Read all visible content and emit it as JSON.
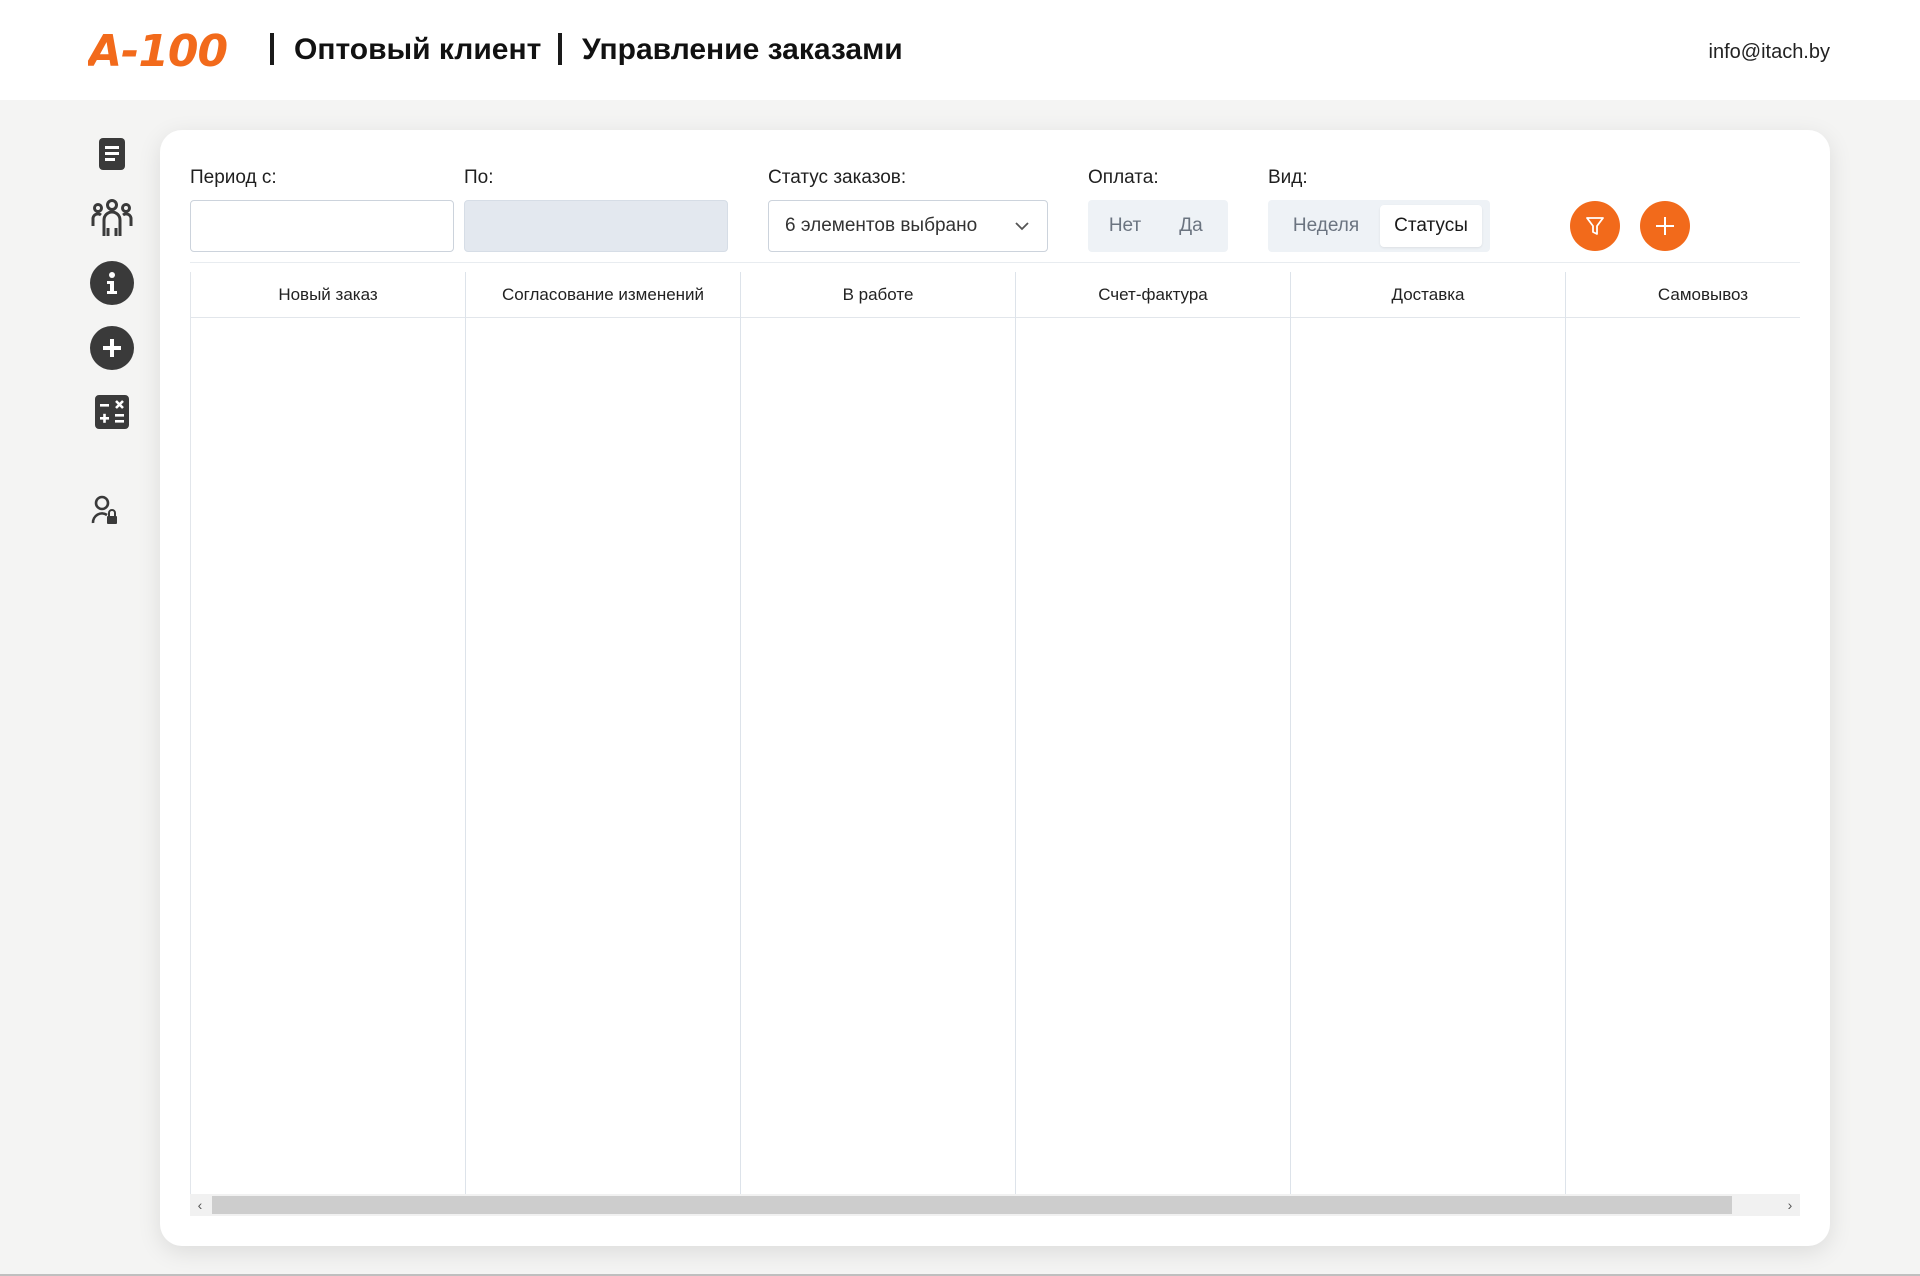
{
  "header": {
    "logo_text": "A-100",
    "title_1": "Оптовый клиент",
    "title_2": "Управление заказами",
    "email": "info@itach.by"
  },
  "sidebar": {
    "items": [
      {
        "name": "document-icon"
      },
      {
        "name": "users-icon"
      },
      {
        "name": "info-icon"
      },
      {
        "name": "add-icon"
      },
      {
        "name": "calculator-icon"
      },
      {
        "name": "user-lock-icon"
      }
    ]
  },
  "filters": {
    "period_from_label": "Период с:",
    "period_from_value": "",
    "period_to_label": "По:",
    "period_to_value": "",
    "status_label": "Статус заказов:",
    "status_value": "6 элементов выбрано",
    "payment_label": "Оплата:",
    "payment_options": [
      "Нет",
      "Да"
    ],
    "view_label": "Вид:",
    "view_options": [
      "Неделя",
      "Статусы"
    ],
    "view_selected": "Статусы"
  },
  "board": {
    "columns": [
      {
        "label": "Новый заказ"
      },
      {
        "label": "Согласование изменений"
      },
      {
        "label": "В работе"
      },
      {
        "label": "Счет-фактура"
      },
      {
        "label": "Доставка"
      },
      {
        "label": "Самовывоз"
      }
    ]
  },
  "colors": {
    "accent": "#f26a1b",
    "icon_dark": "#3a3a3a",
    "background": "#f4f4f3"
  }
}
